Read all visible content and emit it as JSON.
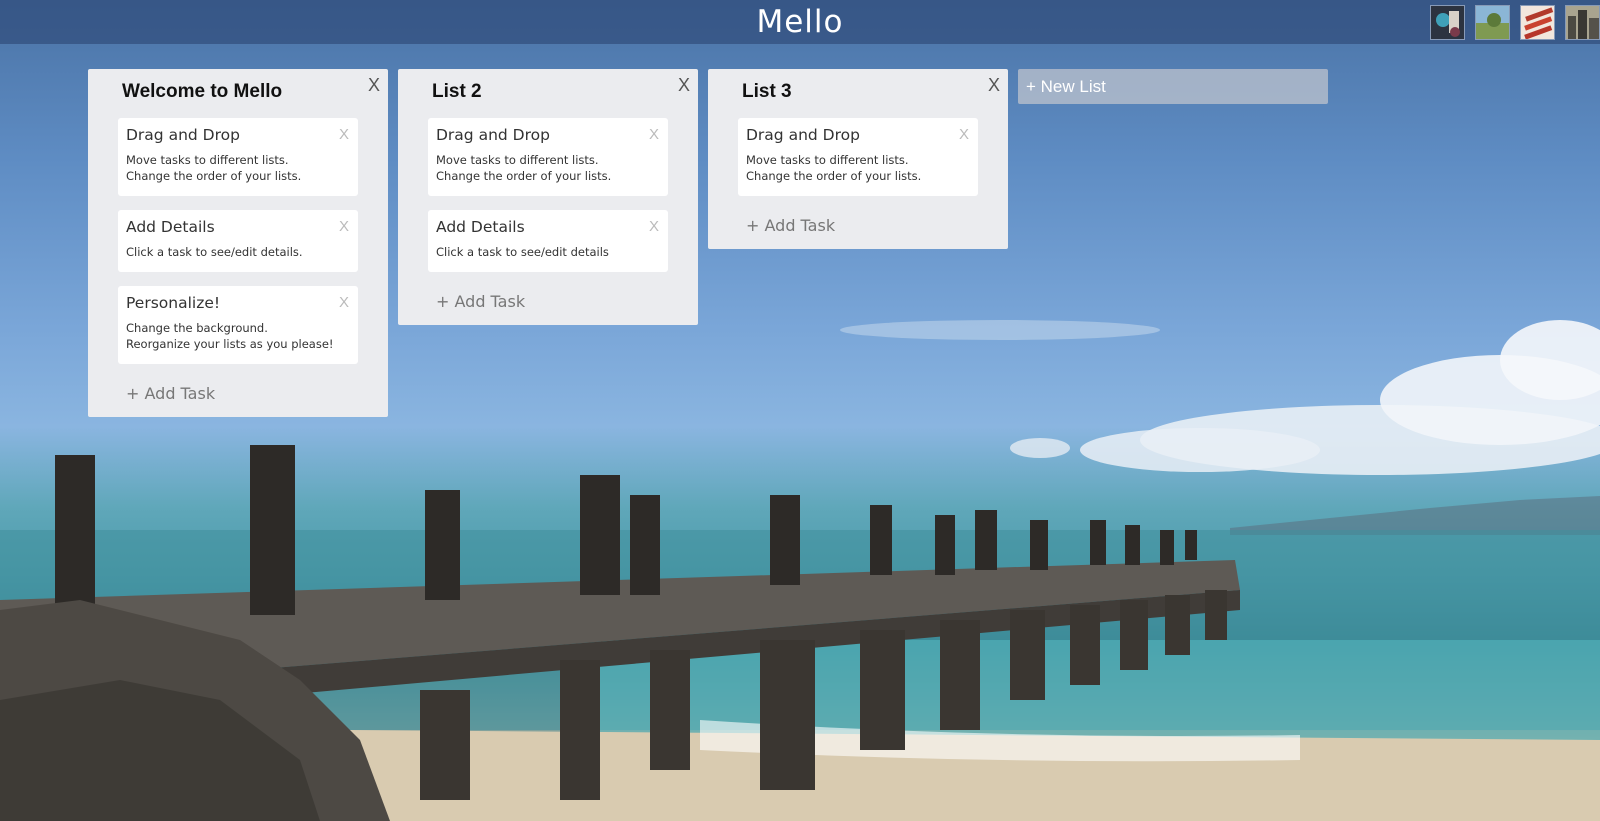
{
  "app": {
    "title": "Mello"
  },
  "backgrounds": [
    {
      "name": "bg-thumb-1"
    },
    {
      "name": "bg-thumb-2"
    },
    {
      "name": "bg-thumb-3"
    },
    {
      "name": "bg-thumb-4"
    }
  ],
  "lists": [
    {
      "title": "Welcome to Mello",
      "close": "X",
      "tasks": [
        {
          "title": "Drag and Drop",
          "close": "X",
          "description": "Move tasks to different lists. Change the order of your lists."
        },
        {
          "title": "Add Details",
          "close": "X",
          "description": "Click a task to see/edit details."
        },
        {
          "title": "Personalize!",
          "close": "X",
          "description": "Change the background. Reorganize your lists as you please!"
        }
      ],
      "add_task": "+ Add Task"
    },
    {
      "title": "List 2",
      "close": "X",
      "tasks": [
        {
          "title": "Drag and Drop",
          "close": "X",
          "description": "Move tasks to different lists. Change the order of your lists."
        },
        {
          "title": "Add Details",
          "close": "X",
          "description": "Click a task to see/edit details"
        }
      ],
      "add_task": "+ Add Task"
    },
    {
      "title": "List 3",
      "close": "X",
      "tasks": [
        {
          "title": "Drag and Drop",
          "close": "X",
          "description": "Move tasks to different lists. Change the order of your lists."
        }
      ],
      "add_task": "+ Add Task"
    }
  ],
  "new_list": {
    "label": "+ New List"
  }
}
